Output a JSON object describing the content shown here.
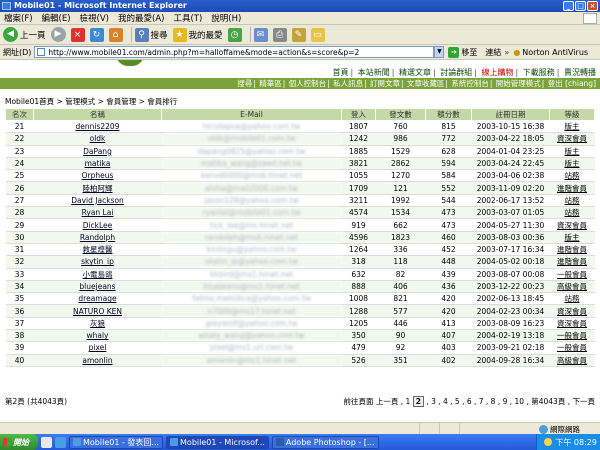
{
  "window": {
    "title": "Mobile01 - Microsoft Internet Explorer"
  },
  "menu": [
    "檔案(F)",
    "編輯(E)",
    "檢視(V)",
    "我的最愛(A)",
    "工具(T)",
    "說明(H)"
  ],
  "toolbar": {
    "back": "上一頁",
    "search": "搜尋",
    "favorites": "我的最愛"
  },
  "address": {
    "label": "網址(D)",
    "url": "http://www.mobile01.com/admin.php?m=halloffame&mode=action&s=score&p=2",
    "go": "移至",
    "links": "連結",
    "antivirus": "Norton AntiVirus"
  },
  "site_nav": {
    "items": [
      "首頁",
      "本站新聞",
      "精選文章",
      "討論群組",
      "線上購物",
      "下載服務",
      "賣況轉播"
    ],
    "highlight_index": 4
  },
  "admin_bar": {
    "items": [
      "搜尋",
      "精華區",
      "個人控制台",
      "私人訊息",
      "訂閱文章",
      "文章收藏區",
      "系統控制台",
      "開始管理模式",
      "登出 [chiang]"
    ]
  },
  "breadcrumb": "Mobile01首頁 > 管理模式 > 會員管理 > 會員排行",
  "table": {
    "headers": [
      "名次",
      "名稱",
      "E-Mail",
      "登入",
      "發文數",
      "積分數",
      "註冊日期",
      "等級"
    ],
    "rows": [
      [
        "21",
        "dennis2209",
        "hlcollapse@yahoo.com.tw",
        "1807",
        "760",
        "815",
        "2003-10-15 16:38",
        "版主"
      ],
      [
        "22",
        "oldk",
        "oldk@mobile01.com.tw",
        "1242",
        "986",
        "772",
        "2003-04-22 18:05",
        "資深會員"
      ],
      [
        "23",
        "DaPang",
        "dapang0825@yahoo.com.tw",
        "1885",
        "1529",
        "628",
        "2004-01-04 23:25",
        "版主"
      ],
      [
        "24",
        "matika",
        "matika_wang@seed.net.tw",
        "3821",
        "2862",
        "594",
        "2003-04-24 22:45",
        "版主"
      ],
      [
        "25",
        "Orpheus",
        "kenvd0000@ms6.hinet.net",
        "1055",
        "1270",
        "584",
        "2003-04-06 02:38",
        "站務"
      ],
      [
        "26",
        "陸柏阿輝",
        "aloha@mail2000.com.tw",
        "1709",
        "121",
        "552",
        "2003-11-09 02:20",
        "進階會員"
      ],
      [
        "27",
        "David Jackson",
        "jason128@yahoo.com.tw",
        "3211",
        "1992",
        "544",
        "2002-06-17 13:52",
        "站務"
      ],
      [
        "28",
        "Ryan Lai",
        "ryanlai@mobile01.com.tw",
        "4574",
        "1534",
        "473",
        "2003-03-07 01:05",
        "站務"
      ],
      [
        "29",
        "DickLee",
        "tick_lee@ms.hinet.net",
        "919",
        "662",
        "473",
        "2004-05-27 11:30",
        "資深會員"
      ],
      [
        "30",
        "Randolph",
        "randolph@ms6.hinet.net",
        "4596",
        "1823",
        "460",
        "2003-08-03 00:36",
        "版主"
      ],
      [
        "31",
        "救星煌醫",
        "kinlingu@yahoo.com.tw",
        "1264",
        "336",
        "452",
        "2003-07-17 16:34",
        "進階會員"
      ],
      [
        "32",
        "skytin_ip",
        "skytin_ip@yahoo.com.tw",
        "318",
        "118",
        "448",
        "2004-05-02 00:18",
        "進階會員"
      ],
      [
        "33",
        "小電島鴿",
        "kkbird@ms1.hinet.net",
        "632",
        "82",
        "439",
        "2003-08-07 00:08",
        "一般會員"
      ],
      [
        "34",
        "bluejeans",
        "bluejeans@ms1.hinet.net",
        "888",
        "406",
        "436",
        "2003-12-22 00:23",
        "高級會員"
      ],
      [
        "35",
        "dreamage",
        "fatma.melodica@yahoo.com.tw",
        "1008",
        "821",
        "420",
        "2002-06-13 18:45",
        "站務"
      ],
      [
        "36",
        "NATURO KEN",
        "n7000@ms17.hinet.net",
        "1288",
        "577",
        "420",
        "2004-02-23 00:34",
        "資深會員"
      ],
      [
        "37",
        "灰狼",
        "greywolf@yahoo.com.tw",
        "1205",
        "446",
        "413",
        "2003-08-09 16:23",
        "資深會員"
      ],
      [
        "38",
        "whaly",
        "whaly_wang@yahoo.com.tw",
        "350",
        "90",
        "407",
        "2004-02-19 13:18",
        "一般會員"
      ],
      [
        "39",
        "pixel",
        "pixel@ms1.url.com.tw",
        "479",
        "92",
        "403",
        "2003-09-21 02:18",
        "一般會員"
      ],
      [
        "40",
        "amonlin",
        "amonlin@ms1.hinet.net",
        "526",
        "351",
        "402",
        "2004-09-28 16:34",
        "高級會員"
      ]
    ]
  },
  "pager": {
    "info": "第2頁 (共4043頁)",
    "prev_label": "前往頁面 上一頁 ,",
    "first": "1",
    "current": "2",
    "pages": ", 3 , 4 , 5 , 6 , 7 , 8 , 9 , 10 ,",
    "last": "第4043頁",
    "next": ", 下一頁"
  },
  "status": {
    "zone": "網際網路"
  },
  "taskbar": {
    "start": "開始",
    "tasks": [
      "Mobile01 - 發表回...",
      "Mobile01 - Microsof...",
      "Adobe Photoshop - [..."
    ],
    "active_index": 1,
    "clock": "下午 08:29"
  },
  "colors": {
    "admin_bar": "#7aa33a",
    "table_header": "#c5d8a8",
    "nav_highlight": "#cc0000"
  }
}
